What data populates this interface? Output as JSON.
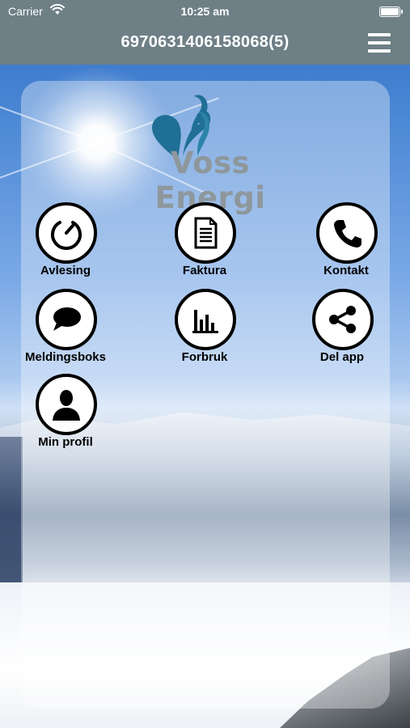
{
  "status_bar": {
    "carrier": "Carrier",
    "time": "10:25 am"
  },
  "nav": {
    "title": "6970631406158068(5)"
  },
  "logo": {
    "text": "Voss Energi"
  },
  "tiles": [
    {
      "label": "Avlesing",
      "icon": "gauge-icon"
    },
    {
      "label": "Faktura",
      "icon": "document-icon"
    },
    {
      "label": "Kontakt",
      "icon": "phone-icon"
    },
    {
      "label": "Meldingsboks",
      "icon": "chat-bubble-icon"
    },
    {
      "label": "Forbruk",
      "icon": "bar-chart-icon"
    },
    {
      "label": "Del app",
      "icon": "share-icon"
    },
    {
      "label": "Min profil",
      "icon": "person-icon"
    }
  ]
}
